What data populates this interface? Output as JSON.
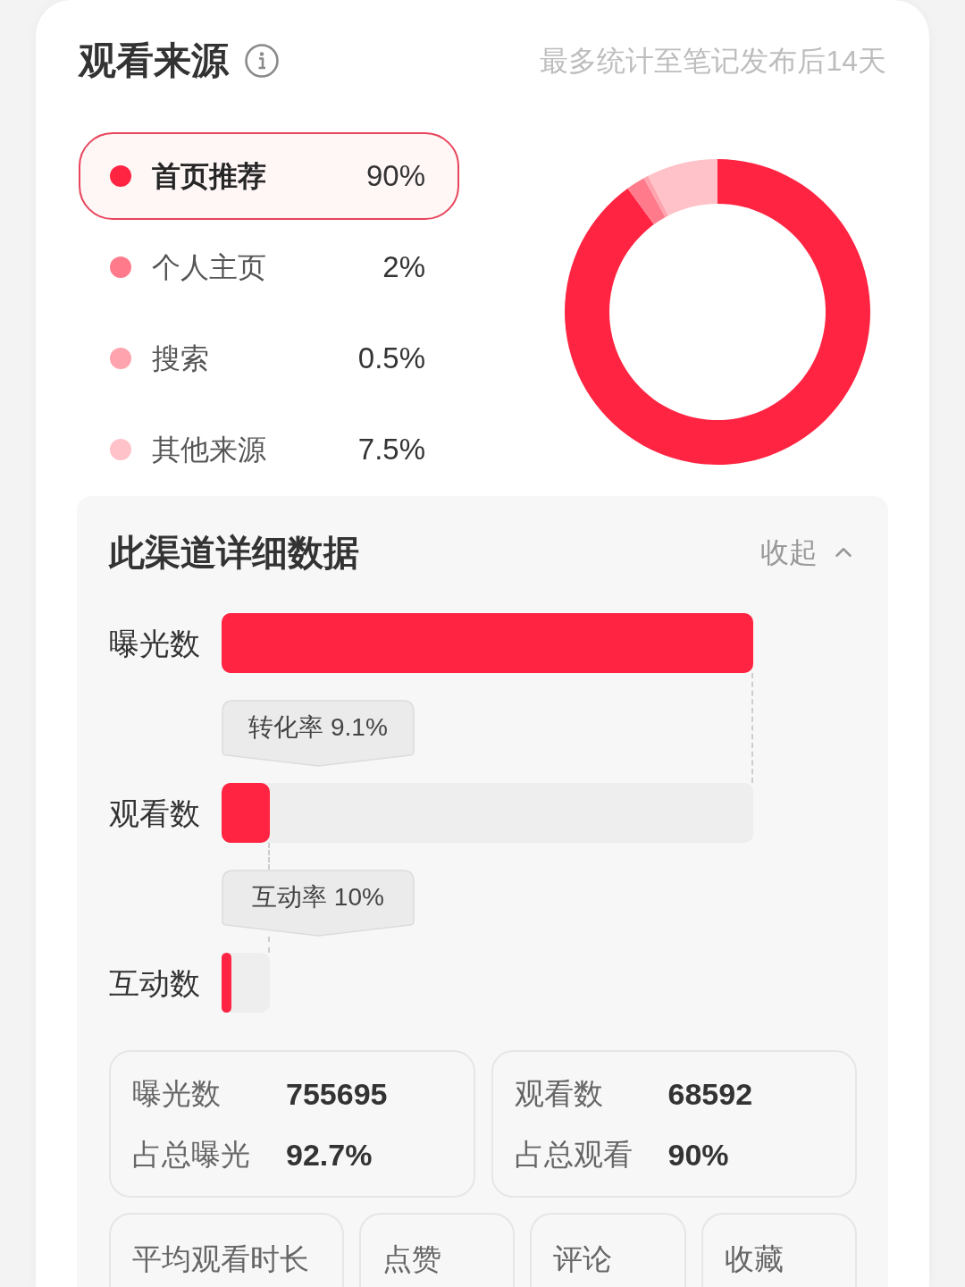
{
  "header": {
    "title": "观看来源",
    "note": "最多统计至笔记发布后14天"
  },
  "sources": {
    "legend": [
      {
        "label": "首页推荐",
        "value": "90%",
        "color": "#ff2442",
        "selected": true
      },
      {
        "label": "个人主页",
        "value": "2%",
        "color": "#ff7b8c",
        "selected": false
      },
      {
        "label": "搜索",
        "value": "0.5%",
        "color": "#ffa3ae",
        "selected": false
      },
      {
        "label": "其他来源",
        "value": "7.5%",
        "color": "#ffc2c9",
        "selected": false
      }
    ],
    "chart_data": {
      "type": "donut",
      "values": [
        90,
        2,
        0.5,
        7.5
      ]
    }
  },
  "detail": {
    "title": "此渠道详细数据",
    "toggle": "收起",
    "expanded": true,
    "funnel": [
      {
        "label": "曝光数"
      },
      {
        "label": "观看数",
        "level": 0.091
      },
      {
        "label": "互动数",
        "level": 0.2
      }
    ],
    "rates": [
      "转化率 9.1%",
      "互动率 10%"
    ],
    "summary_cards": [
      {
        "rows": [
          {
            "label": "曝光数",
            "value": "755695"
          },
          {
            "label": "占总曝光",
            "value": "92.7%"
          }
        ]
      },
      {
        "rows": [
          {
            "label": "观看数",
            "value": "68592"
          },
          {
            "label": "占总观看",
            "value": "90%"
          }
        ]
      }
    ],
    "metric_cards": [
      {
        "label": "平均观看时长"
      },
      {
        "label": "点赞"
      },
      {
        "label": "评论"
      },
      {
        "label": "收藏"
      }
    ]
  }
}
